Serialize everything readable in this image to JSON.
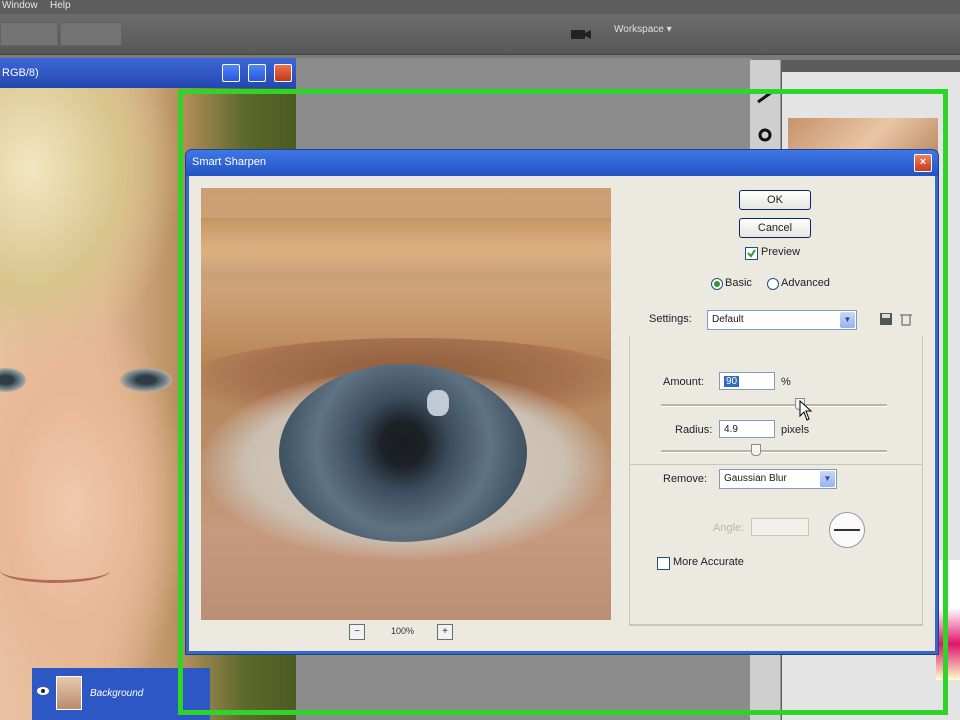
{
  "app": {
    "menu_fragment_left": "Window",
    "menu_fragment_right": "Help",
    "options_ghost_1": "",
    "options_ghost_2": "",
    "workspace_label": "Workspace ▾"
  },
  "document_window": {
    "title": "RGB/8)"
  },
  "layers_panel": {
    "layer_name": "Background"
  },
  "dialog": {
    "title": "Smart Sharpen",
    "ok_label": "OK",
    "cancel_label": "Cancel",
    "preview_label": "Preview",
    "preview_checked": true,
    "mode_basic_label": "Basic",
    "mode_advanced_label": "Advanced",
    "mode_selected": "Basic",
    "settings_label": "Settings:",
    "settings_value": "Default",
    "amount_label": "Amount:",
    "amount_value": "90",
    "amount_unit": "%",
    "radius_label": "Radius:",
    "radius_value": "4.9",
    "radius_unit": "pixels",
    "remove_label": "Remove:",
    "remove_value": "Gaussian Blur",
    "angle_label": "Angle:",
    "angle_value": "",
    "more_accurate_label": "More Accurate",
    "more_accurate_checked": false,
    "zoom_value": "100%",
    "zoom_out_symbol": "−",
    "zoom_in_symbol": "+"
  },
  "icons": [
    "close-icon",
    "minimize-icon",
    "maximize-icon",
    "save-settings-icon",
    "delete-settings-icon",
    "eye-icon",
    "cursor-icon",
    "camera-icon"
  ],
  "colors": {
    "highlight_frame": "#2ed42a",
    "title_bar_blue": "#2352c1",
    "dialog_face": "#ebe9e0"
  }
}
